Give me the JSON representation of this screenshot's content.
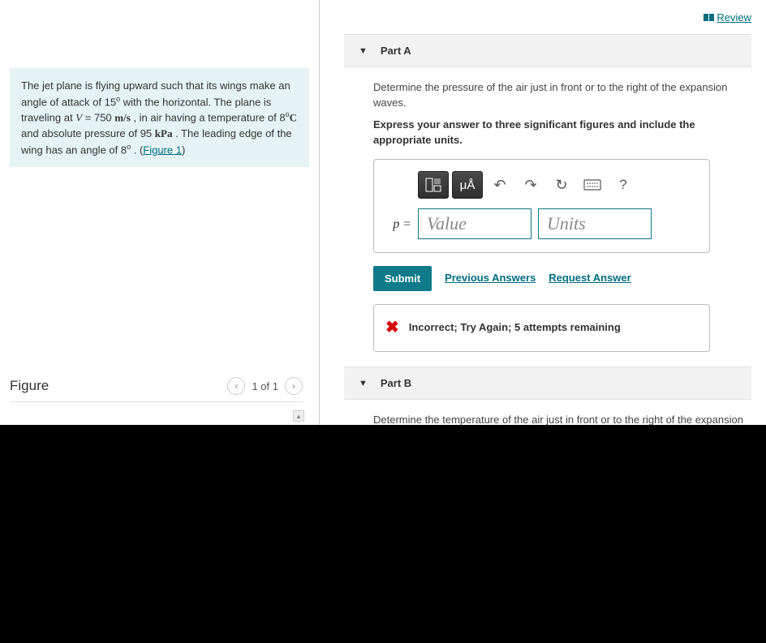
{
  "review": {
    "label": "Review"
  },
  "problem": {
    "text_1": "The jet plane is flying upward such that its wings make an angle of attack of 15",
    "deg": "o",
    "text_2": " with the horizontal. The plane is traveling at ",
    "V_label": "V",
    "eq": " = 750 ",
    "units_ms": "m/s",
    "text_3": " , in air having a temperature of 8",
    "deg2": "o",
    "C": "C",
    "text_4": " and absolute pressure of 95 ",
    "kpa": "kPa",
    "text_5": " . The leading edge of the wing has an angle of 8",
    "deg3": "o",
    "text_6": " . (",
    "figlink": "Figure 1",
    "text_7": ")"
  },
  "figure": {
    "title": "Figure",
    "pager": "1 of 1"
  },
  "partA": {
    "title": "Part A",
    "prompt": "Determine the pressure of the air just in front or to the right of the expansion waves.",
    "instr": "Express your answer to three significant figures and include the appropriate units.",
    "var": "p =",
    "value_ph": "Value",
    "units_ph": "Units",
    "submit": "Submit",
    "prev": "Previous Answers",
    "req": "Request Answer",
    "feedback": "Incorrect; Try Again; 5 attempts remaining",
    "toolbar": {
      "units_btn": "μÅ",
      "help": "?"
    }
  },
  "partB": {
    "title": "Part B",
    "prompt": "Determine the temperature of the air just in front or to the right of the expansion"
  }
}
